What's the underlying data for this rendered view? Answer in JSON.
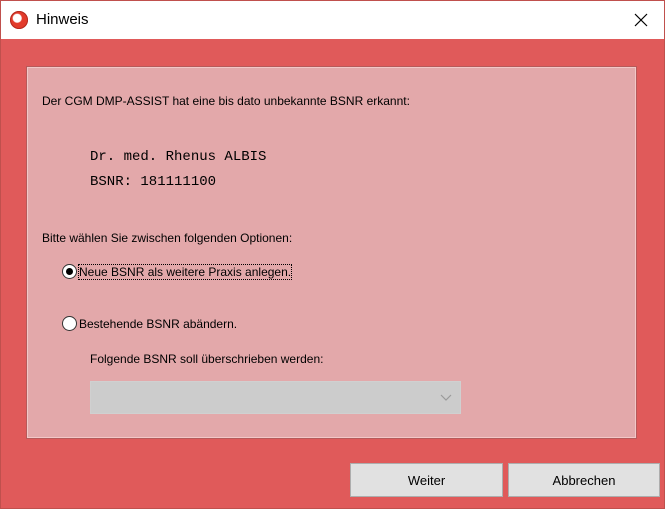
{
  "window": {
    "title": "Hinweis",
    "close_glyph": "close-icon",
    "app_icon": "app-logo-icon",
    "accent_color": "#e05a5a",
    "panel_color": "#e3a8aa"
  },
  "content": {
    "message": "Der CGM DMP-ASSIST hat eine bis dato unbekannte BSNR erkannt:",
    "doctor_name": "Dr. med. Rhenus ALBIS",
    "bsnr_line": "BSNR: 181111100",
    "prompt": "Bitte wählen Sie zwischen folgenden Optionen:",
    "options": [
      {
        "label": "Neue BSNR als weitere Praxis anlegen.",
        "selected": true
      },
      {
        "label": "Bestehende BSNR abändern.",
        "selected": false
      }
    ],
    "overwrite_label": "Folgende BSNR soll überschrieben werden:",
    "overwrite_select_value": ""
  },
  "buttons": {
    "next": "Weiter",
    "cancel": "Abbrechen"
  }
}
